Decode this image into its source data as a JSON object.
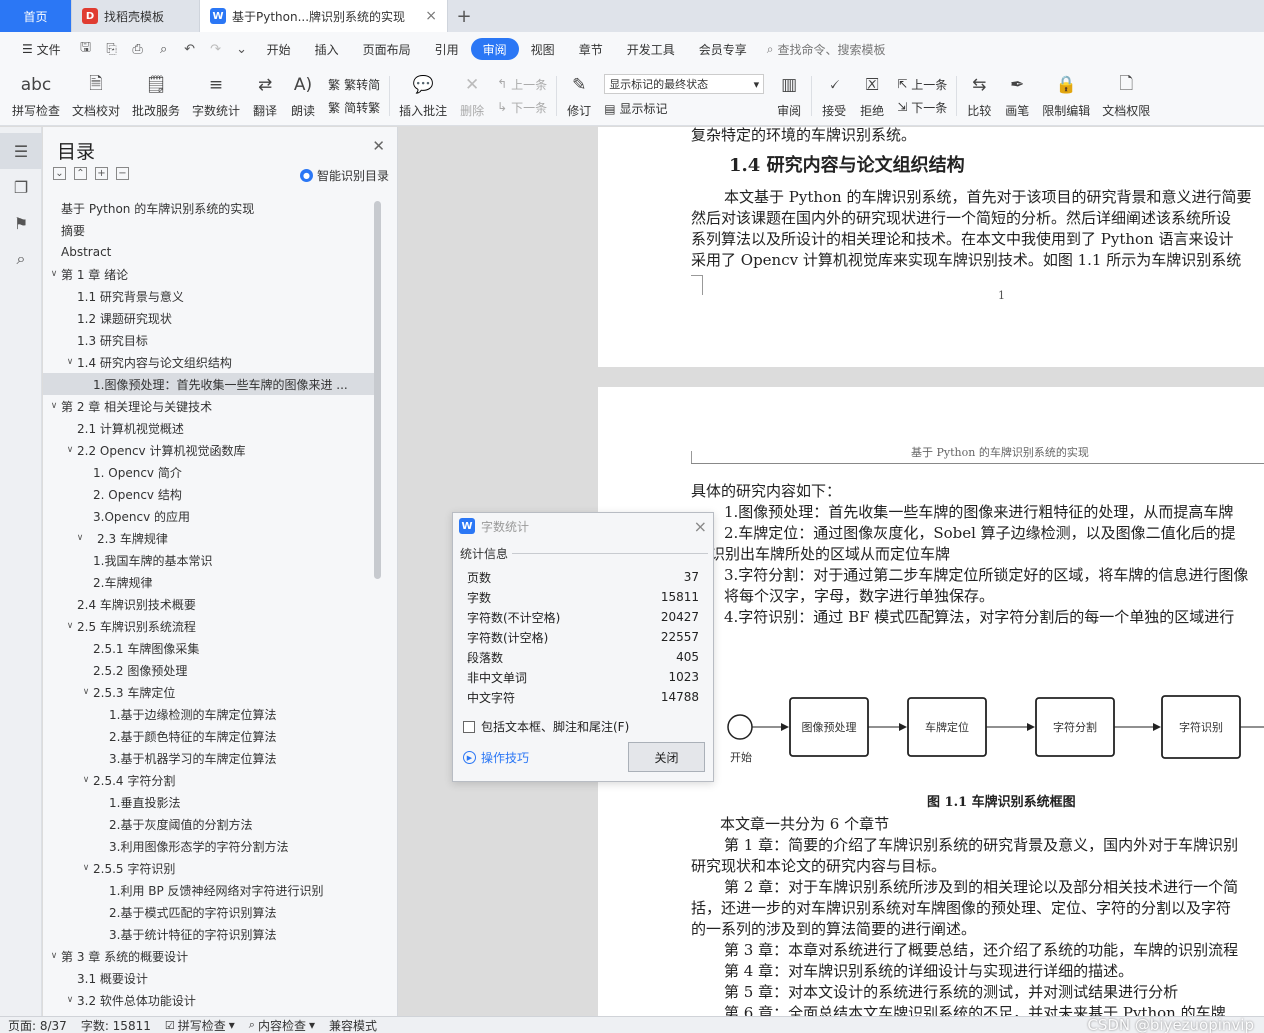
{
  "tabs": {
    "home": "首页",
    "daoke": "找稻壳模板",
    "doc": "基于Python...牌识别系统的实现",
    "add": "+"
  },
  "menu": {
    "file": "文件",
    "items": [
      "开始",
      "插入",
      "页面布局",
      "引用",
      "审阅",
      "视图",
      "章节",
      "开发工具",
      "会员专享"
    ],
    "search": "查找命令、搜索模板"
  },
  "ribbon": {
    "spell": "拼写检查",
    "proof": "文档校对",
    "batch": "批改服务",
    "count": "字数统计",
    "translate": "翻译",
    "read": "朗读",
    "to_trad": "繁转简",
    "to_simp": "简转繁",
    "insert_comment": "插入批注",
    "delete": "删除",
    "prev": "上一条",
    "next": "下一条",
    "revise": "修订",
    "markup_select": "显示标记的最终状态",
    "show_markup": "显示标记",
    "review": "审阅",
    "accept": "接受",
    "reject": "拒绝",
    "prev2": "上一条",
    "next2": "下一条",
    "compare": "比较",
    "pen": "画笔",
    "restrict": "限制编辑",
    "perm": "文档权限"
  },
  "toc": {
    "title": "目录",
    "smart": "智能识别目录",
    "items": [
      {
        "label": "基于 Python 的车牌识别系统的实现",
        "level": 0,
        "arrow": ""
      },
      {
        "label": "摘要",
        "level": 0,
        "arrow": ""
      },
      {
        "label": "Abstract",
        "level": 0,
        "arrow": ""
      },
      {
        "label": "第 1 章  绪论",
        "level": 0,
        "arrow": "v"
      },
      {
        "label": "1.1 研究背景与意义",
        "level": 1,
        "arrow": ""
      },
      {
        "label": "1.2 课题研究现状",
        "level": 1,
        "arrow": ""
      },
      {
        "label": "1.3 研究目标",
        "level": 1,
        "arrow": ""
      },
      {
        "label": "1.4 研究内容与论文组织结构",
        "level": 1,
        "arrow": "v"
      },
      {
        "label": "1.图像预处理：首先收集一些车牌的图像来进 ...",
        "level": 2,
        "arrow": "",
        "selected": true
      },
      {
        "label": "第 2 章  相关理论与关键技术",
        "level": 0,
        "arrow": "v"
      },
      {
        "label": "2.1 计算机视觉概述",
        "level": 1,
        "arrow": ""
      },
      {
        "label": "2.2 Opencv 计算机视觉函数库",
        "level": 1,
        "arrow": "v"
      },
      {
        "label": "1. Opencv 简介",
        "level": 2,
        "arrow": ""
      },
      {
        "label": "2. Opencv 结构",
        "level": 2,
        "arrow": ""
      },
      {
        "label": "3.Opencv 的应用",
        "level": 2,
        "arrow": ""
      },
      {
        "label": "2.3 车牌规律",
        "level": 1,
        "arrow": "v",
        "wide": true
      },
      {
        "label": "1.我国车牌的基本常识",
        "level": 2,
        "arrow": ""
      },
      {
        "label": "2.车牌规律",
        "level": 2,
        "arrow": ""
      },
      {
        "label": "2.4 车牌识别技术概要",
        "level": 1,
        "arrow": ""
      },
      {
        "label": "2.5 车牌识别系统流程",
        "level": 1,
        "arrow": "v"
      },
      {
        "label": "2.5.1 车牌图像采集",
        "level": 2,
        "arrow": ""
      },
      {
        "label": "2.5.2 图像预处理",
        "level": 2,
        "arrow": ""
      },
      {
        "label": "2.5.3 车牌定位",
        "level": 2,
        "arrow": "v"
      },
      {
        "label": "1.基于边缘检测的车牌定位算法",
        "level": 3,
        "arrow": ""
      },
      {
        "label": "2.基于颜色特征的车牌定位算法",
        "level": 3,
        "arrow": ""
      },
      {
        "label": "3.基于机器学习的车牌定位算法",
        "level": 3,
        "arrow": ""
      },
      {
        "label": "2.5.4 字符分割",
        "level": 2,
        "arrow": "v"
      },
      {
        "label": "1.垂直投影法",
        "level": 3,
        "arrow": ""
      },
      {
        "label": "2.基于灰度阈值的分割方法",
        "level": 3,
        "arrow": ""
      },
      {
        "label": "3.利用图像形态学的字符分割方法",
        "level": 3,
        "arrow": ""
      },
      {
        "label": "2.5.5 字符识别",
        "level": 2,
        "arrow": "v"
      },
      {
        "label": "1.利用 BP 反馈神经网络对字符进行识别",
        "level": 3,
        "arrow": ""
      },
      {
        "label": "2.基于模式匹配的字符识别算法",
        "level": 3,
        "arrow": ""
      },
      {
        "label": "3.基于统计特征的字符识别算法",
        "level": 3,
        "arrow": ""
      },
      {
        "label": "第 3 章  系统的概要设计",
        "level": 0,
        "arrow": "v"
      },
      {
        "label": "3.1 概要设计",
        "level": 1,
        "arrow": ""
      },
      {
        "label": "3.2 软件总体功能设计",
        "level": 1,
        "arrow": "v"
      }
    ]
  },
  "doc": {
    "page1": {
      "top_line": "复杂特定的环境的车牌识别系统。",
      "heading": "1.4 研究内容与论文组织结构",
      "para": [
        "本文基于 Python 的车牌识别系统，首先对于该项目的研究背景和意义进行简要",
        "然后对该课题在国内外的研究现状进行一个简短的分析。然后详细阐述该系统所设",
        "系列算法以及所设计的相关理论和技术。在本文中我使用到了 Python 语言来设计",
        "采用了 Opencv 计算机视觉库来实现车牌识别技术。如图 1.1 所示为车牌识别系统"
      ],
      "page_num": "1"
    },
    "page2": {
      "header": "基于 Python 的车牌识别系统的实现",
      "lines": [
        "具体的研究内容如下：",
        "1.图像预处理：首先收集一些车牌的图像来进行粗特征的处理，从而提高车牌",
        "2.车牌定位：通过图像灰度化，Sobel 算子边缘检测，以及图像二值化后的提",
        "识别出车牌所处的区域从而定位车牌",
        "3.字符分割：对于通过第二步车牌定位所锁定好的区域，将车牌的信息进行图像",
        "将每个汉字，字母，数字进行单独保存。",
        "4.字符识别：通过 BF 模式匹配算法，对字符分割后的每一个单独的区域进行"
      ],
      "flow": {
        "start": "开始",
        "boxes": [
          "图像预处理",
          "车牌定位",
          "字符分割",
          "字符识别"
        ]
      },
      "caption": "图 1.1 车牌识别系统框图",
      "body": [
        "本文章一共分为 6 个章节",
        "第 1 章：简要的介绍了车牌识别系统的研究背景及意义，国内外对于车牌识别",
        "研究现状和本论文的研究内容与目标。",
        "第 2 章：对于车牌识别系统所涉及到的相关理论以及部分相关技术进行一个简",
        "括，还进一步的对车牌识别系统对车牌图像的预处理、定位、字符的分割以及字符",
        "的一系列的涉及到的算法简要的进行阐述。",
        "第 3 章：本章对系统进行了概要总结，还介绍了系统的功能，车牌的识别流程",
        "第 4 章：对车牌识别系统的详细设计与实现进行详细的描述。",
        "第 5 章：对本文设计的系统进行系统的测试，并对测试结果进行分析",
        "第 6 章：全面总结本文车牌识别系统的不足，并对未来基于 Python 的车牌"
      ]
    }
  },
  "dialog": {
    "title": "字数统计",
    "section": "统计信息",
    "stats": [
      {
        "label": "页数",
        "value": "37"
      },
      {
        "label": "字数",
        "value": "15811"
      },
      {
        "label": "字符数(不计空格)",
        "value": "20427"
      },
      {
        "label": "字符数(计空格)",
        "value": "22557"
      },
      {
        "label": "段落数",
        "value": "405"
      },
      {
        "label": "非中文单词",
        "value": "1023"
      },
      {
        "label": "中文字符",
        "value": "14788"
      }
    ],
    "checkbox": "包括文本框、脚注和尾注(F)",
    "tips": "操作技巧",
    "close": "关闭"
  },
  "status": {
    "page": "页面: 8/37",
    "words": "字数: 15811",
    "spell": "拼写检查",
    "content": "内容检查",
    "compat": "兼容模式",
    "watermark": "CSDN @biyezuopinvip"
  },
  "colors": {
    "accent": "#2b77f5",
    "tab_bar": "#dfe3ea",
    "canvas": "#dcdcdc"
  }
}
